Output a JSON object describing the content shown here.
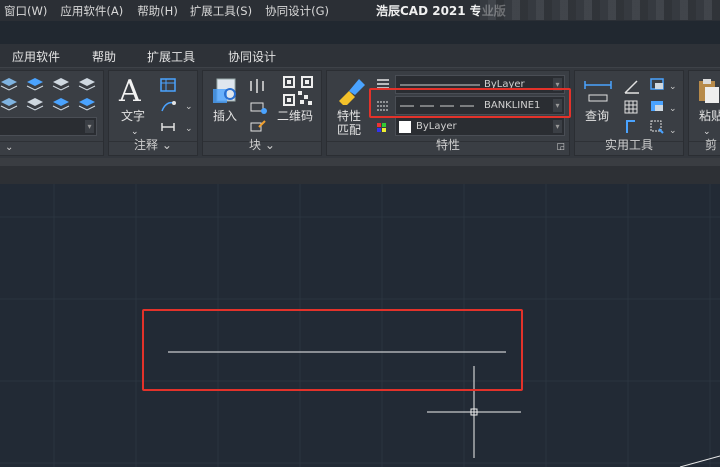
{
  "app": {
    "title": "浩辰CAD 2021 专业版"
  },
  "menu": [
    {
      "label": "窗口(W)"
    },
    {
      "label": "应用软件(A)"
    },
    {
      "label": "帮助(H)"
    },
    {
      "label": "扩展工具(S)"
    },
    {
      "label": "协同设计(G)"
    }
  ],
  "ribbon_tabs": [
    {
      "label": "应用软件"
    },
    {
      "label": "帮助"
    },
    {
      "label": "扩展工具"
    },
    {
      "label": "协同设计"
    }
  ],
  "panels": {
    "annotation": {
      "label": "注释",
      "text_button": "文字"
    },
    "block": {
      "label": "块",
      "insert_button": "插入",
      "qrcode_button": "二维码"
    },
    "properties": {
      "label": "特性",
      "match_button_line1": "特性",
      "match_button_line2": "匹配",
      "lineweight_value": "ByLayer",
      "linetype_value": "BANKLINE1",
      "color_value": "ByLayer"
    },
    "utilities": {
      "label": "实用工具",
      "query_button": "查询"
    },
    "clipboard": {
      "paste_button": "粘贴",
      "label": "剪"
    }
  },
  "colors": {
    "highlight": "#e3322a",
    "canvas": "#222a35",
    "ribbon": "#3a3e44"
  }
}
